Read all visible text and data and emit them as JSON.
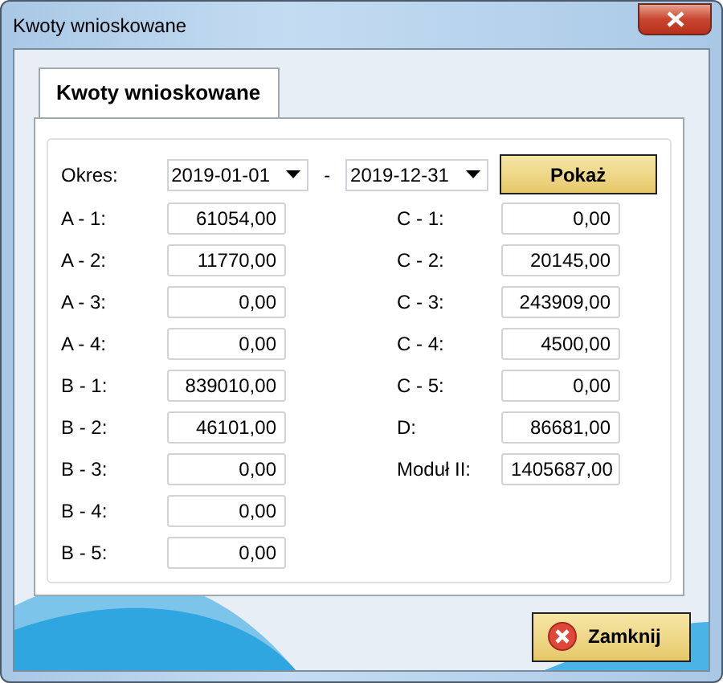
{
  "window": {
    "title": "Kwoty wnioskowane"
  },
  "tabs": [
    {
      "label": "Kwoty wnioskowane",
      "selected": true
    }
  ],
  "period": {
    "label": "Okres:",
    "from": "2019-01-01",
    "separator": "-",
    "to": "2019-12-31"
  },
  "show_button": "Pokaż",
  "left_fields": [
    {
      "label": "A - 1:",
      "value": "61054,00"
    },
    {
      "label": "A - 2:",
      "value": "11770,00"
    },
    {
      "label": "A - 3:",
      "value": "0,00"
    },
    {
      "label": "A - 4:",
      "value": "0,00"
    },
    {
      "label": "B - 1:",
      "value": "839010,00"
    },
    {
      "label": "B - 2:",
      "value": "46101,00"
    },
    {
      "label": "B - 3:",
      "value": "0,00"
    },
    {
      "label": "B - 4:",
      "value": "0,00"
    },
    {
      "label": "B - 5:",
      "value": "0,00"
    }
  ],
  "right_fields": [
    {
      "label": "C - 1:",
      "value": "0,00"
    },
    {
      "label": "C - 2:",
      "value": "20145,00"
    },
    {
      "label": "C - 3:",
      "value": "243909,00"
    },
    {
      "label": "C - 4:",
      "value": "4500,00"
    },
    {
      "label": "C - 5:",
      "value": "0,00"
    },
    {
      "label": "D:",
      "value": "86681,00"
    },
    {
      "label": "Moduł II:",
      "value": "1405687,00"
    }
  ],
  "close_button": "Zamknij"
}
